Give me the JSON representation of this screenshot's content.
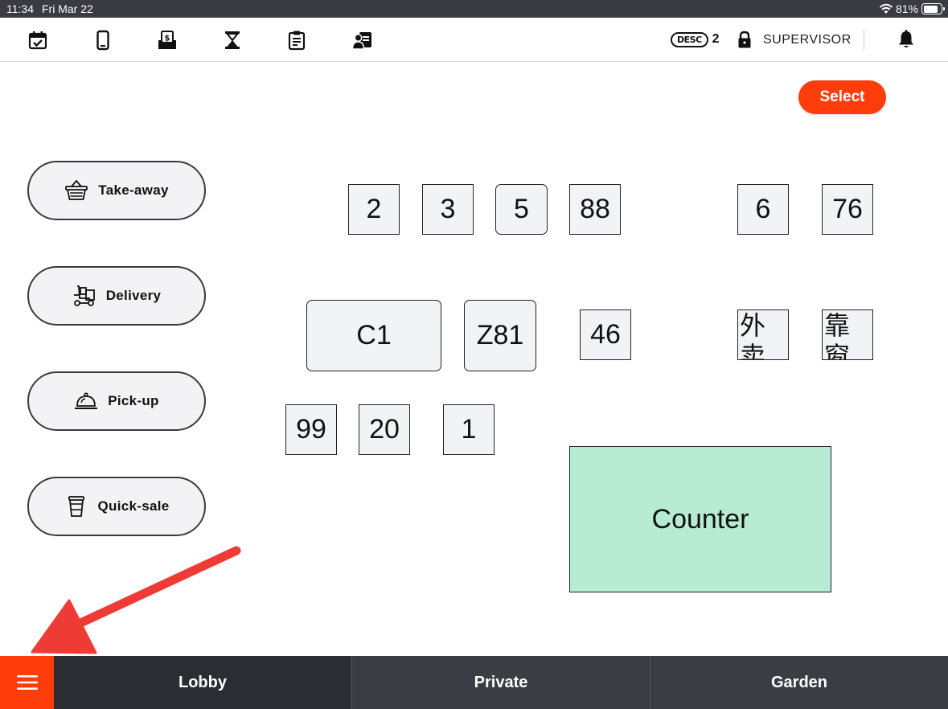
{
  "status_bar": {
    "time": "11:34",
    "date": "Fri Mar 22",
    "battery": "81%"
  },
  "toolbar": {
    "icons": [
      "calendar-check-icon",
      "tablet-icon",
      "cash-drawer-icon",
      "hourglass-icon",
      "clipboard-icon",
      "staff-card-icon"
    ],
    "desc_label": "DESC",
    "desc_count": "2",
    "role": "SUPERVISOR"
  },
  "select_button": "Select",
  "order_types": [
    {
      "label": "Take-away",
      "icon": "basket-icon"
    },
    {
      "label": "Delivery",
      "icon": "delivery-icon"
    },
    {
      "label": "Pick-up",
      "icon": "cloche-icon"
    },
    {
      "label": "Quick-sale",
      "icon": "cup-icon"
    }
  ],
  "tables": [
    "2",
    "3",
    "5",
    "88",
    "6",
    "76",
    "C1",
    "Z81",
    "46",
    "外卖",
    "靠窗",
    "99",
    "20",
    "1"
  ],
  "counter": "Counter",
  "zones": [
    "Lobby",
    "Private",
    "Garden"
  ],
  "active_zone": "Lobby",
  "colors": {
    "accent": "#ff3d0b",
    "bar": "#3b3d44",
    "table_fill": "#f2f3f6",
    "counter_fill": "#b8ebd3",
    "arrow": "#ef3b36"
  }
}
